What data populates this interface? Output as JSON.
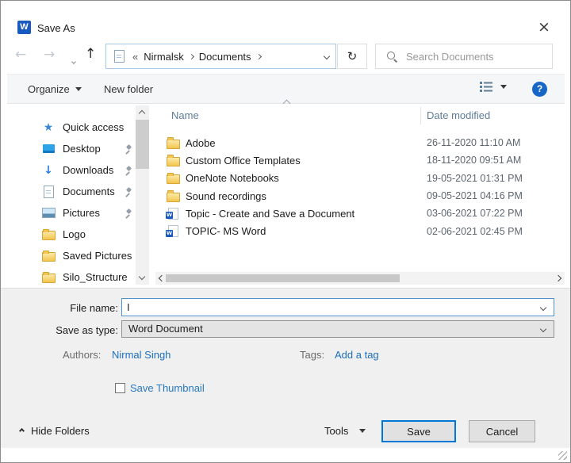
{
  "window": {
    "title": "Save As"
  },
  "nav": {
    "breadcrumb": {
      "collapsed": "«",
      "items": [
        "Nirmalsk",
        "Documents"
      ]
    },
    "search_placeholder": "Search Documents"
  },
  "toolbar": {
    "organize": "Organize",
    "new_folder": "New folder"
  },
  "sidebar": {
    "items": [
      {
        "label": "Quick access",
        "icon": "star",
        "pinned": false
      },
      {
        "label": "Desktop",
        "icon": "desktop",
        "pinned": true
      },
      {
        "label": "Downloads",
        "icon": "downloads",
        "pinned": true
      },
      {
        "label": "Documents",
        "icon": "document",
        "pinned": true
      },
      {
        "label": "Pictures",
        "icon": "pictures",
        "pinned": true
      },
      {
        "label": "Logo",
        "icon": "folder",
        "pinned": false
      },
      {
        "label": "Saved Pictures",
        "icon": "folder",
        "pinned": false
      },
      {
        "label": "Silo_Structure",
        "icon": "folder",
        "pinned": false
      }
    ]
  },
  "file_list": {
    "columns": [
      "Name",
      "Date modified"
    ],
    "rows": [
      {
        "name": "Adobe",
        "icon": "folder",
        "date": "26-11-2020 11:10 AM"
      },
      {
        "name": "Custom Office Templates",
        "icon": "folder",
        "date": "18-11-2020 09:51 AM"
      },
      {
        "name": "OneNote Notebooks",
        "icon": "folder",
        "date": "19-05-2021 01:31 PM"
      },
      {
        "name": "Sound recordings",
        "icon": "folder",
        "date": "09-05-2021 04:16 PM"
      },
      {
        "name": "Topic - Create and Save a Document",
        "icon": "word",
        "date": "03-06-2021 07:22 PM"
      },
      {
        "name": "TOPIC- MS Word",
        "icon": "word",
        "date": "02-06-2021 02:45 PM"
      }
    ]
  },
  "form": {
    "file_name_label": "File name:",
    "file_name_value": "I",
    "save_as_type_label": "Save as type:",
    "save_as_type_value": "Word Document",
    "authors_label": "Authors:",
    "authors_value": "Nirmal Singh",
    "tags_label": "Tags:",
    "tags_value": "Add a tag",
    "save_thumbnail_label": "Save Thumbnail",
    "save_thumbnail_checked": false
  },
  "footer": {
    "hide_folders": "Hide Folders",
    "tools": "Tools",
    "save": "Save",
    "cancel": "Cancel"
  },
  "colors": {
    "accent": "#0078d7",
    "link": "#1d6fbe",
    "folder_yellow": "#f2c64e",
    "word_blue": "#185abd",
    "column_header": "#5e7c99",
    "panel_grey": "#f0f0f0"
  }
}
